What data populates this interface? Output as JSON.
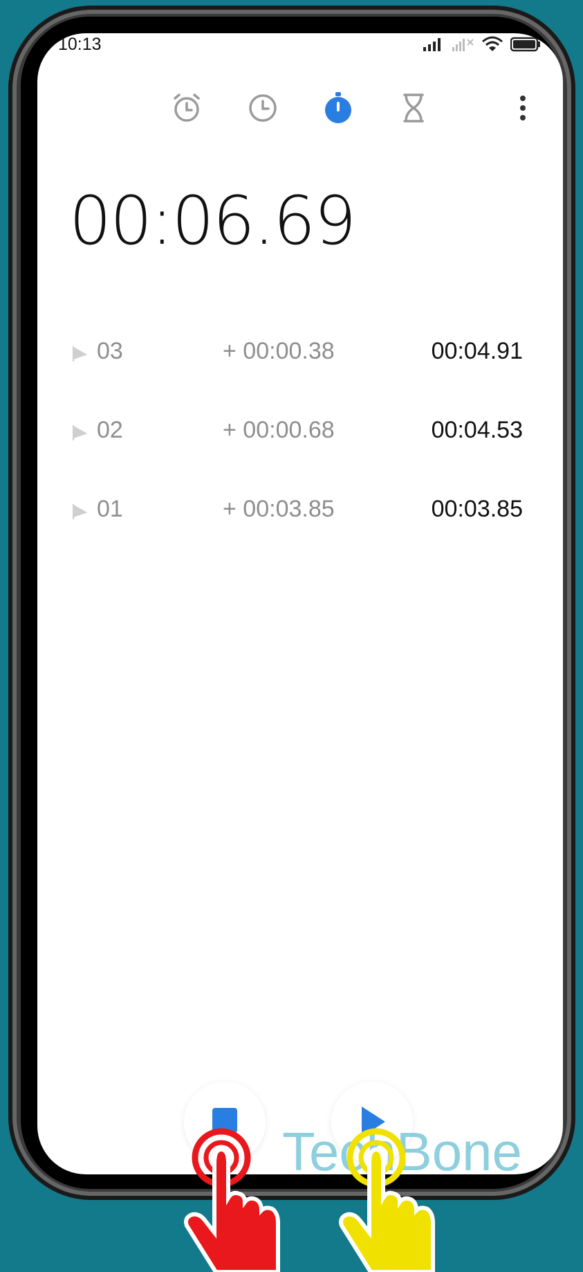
{
  "status": {
    "time": "10:13"
  },
  "tabs": [
    {
      "name": "alarm",
      "icon": "alarm-icon"
    },
    {
      "name": "clock",
      "icon": "clock-icon"
    },
    {
      "name": "stopwatch",
      "icon": "stopwatch-icon",
      "active": true
    },
    {
      "name": "timer",
      "icon": "hourglass-icon"
    }
  ],
  "stopwatch": {
    "elapsed": "00:06.69"
  },
  "laps": [
    {
      "number": "03",
      "diff": "+ 00:00.38",
      "total": "00:04.91"
    },
    {
      "number": "02",
      "diff": "+ 00:00.68",
      "total": "00:04.53"
    },
    {
      "number": "01",
      "diff": "+ 00:03.85",
      "total": "00:03.85"
    }
  ],
  "colors": {
    "accent": "#2a7de1",
    "background": "#137a8c",
    "hand_left": "#e8181c",
    "hand_right": "#f1e100"
  },
  "watermark": "TechBone"
}
